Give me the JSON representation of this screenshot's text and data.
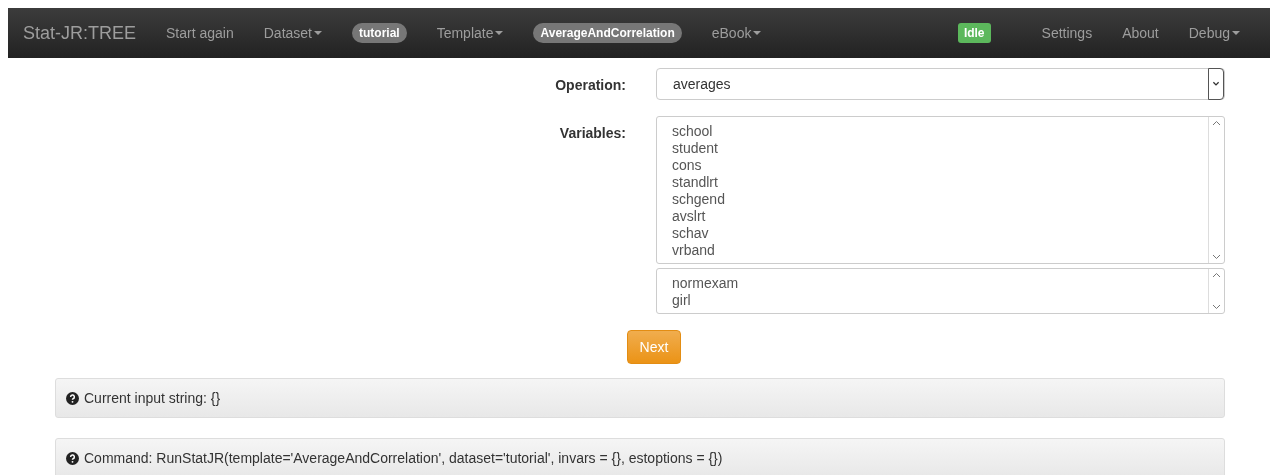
{
  "navbar": {
    "brand": "Stat-JR:TREE",
    "items": [
      {
        "kind": "link",
        "label": "Start again"
      },
      {
        "kind": "dropdown",
        "label": "Dataset"
      },
      {
        "kind": "badge",
        "label": "tutorial"
      },
      {
        "kind": "dropdown",
        "label": "Template"
      },
      {
        "kind": "badge",
        "label": "AverageAndCorrelation"
      },
      {
        "kind": "dropdown",
        "label": "eBook"
      },
      {
        "kind": "spacer"
      },
      {
        "kind": "status",
        "label": "Idle"
      },
      {
        "kind": "link",
        "label": "Settings"
      },
      {
        "kind": "link",
        "label": "About"
      },
      {
        "kind": "dropdown",
        "label": "Debug"
      }
    ]
  },
  "form": {
    "operation": {
      "label": "Operation:",
      "value": "averages"
    },
    "variables": {
      "label": "Variables:",
      "available": [
        "school",
        "student",
        "cons",
        "standlrt",
        "schgend",
        "avslrt",
        "schav",
        "vrband"
      ],
      "chosen": [
        "normexam",
        "girl"
      ]
    },
    "next_button": "Next"
  },
  "panels": [
    {
      "text": "Current input string: {}"
    },
    {
      "text": "Command: RunStatJR(template='AverageAndCorrelation', dataset='tutorial', invars = {}, estoptions = {})"
    }
  ]
}
